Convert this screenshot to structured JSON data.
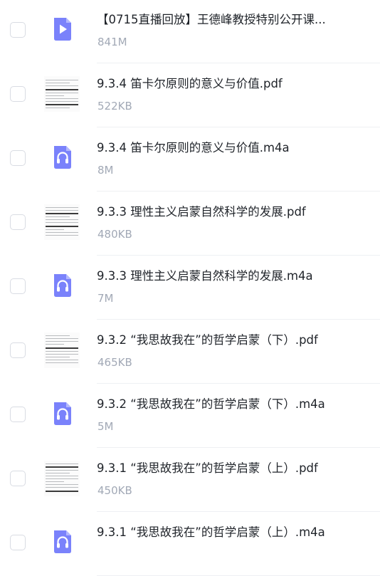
{
  "files": [
    {
      "name": "【0715直播回放】王德峰教授特别公开课...",
      "size": "841M",
      "type": "video",
      "icon": "play-icon"
    },
    {
      "name": "9.3.4 笛卡尔原则的意义与价值.pdf",
      "size": "522KB",
      "type": "pdf",
      "icon": "pdf-thumbnail-icon"
    },
    {
      "name": "9.3.4 笛卡尔原则的意义与价值.m4a",
      "size": "8M",
      "type": "audio",
      "icon": "headphones-icon"
    },
    {
      "name": "9.3.3 理性主义启蒙自然科学的发展.pdf",
      "size": "480KB",
      "type": "pdf",
      "icon": "pdf-thumbnail-icon"
    },
    {
      "name": "9.3.3 理性主义启蒙自然科学的发展.m4a",
      "size": "7M",
      "type": "audio",
      "icon": "headphones-icon"
    },
    {
      "name": "9.3.2 “我思故我在”的哲学启蒙（下）.pdf",
      "size": "465KB",
      "type": "pdf",
      "icon": "pdf-thumbnail-icon"
    },
    {
      "name": "9.3.2 “我思故我在”的哲学启蒙（下）.m4a",
      "size": "5M",
      "type": "audio",
      "icon": "headphones-icon"
    },
    {
      "name": "9.3.1 “我思故我在”的哲学启蒙（上）.pdf",
      "size": "450KB",
      "type": "pdf",
      "icon": "pdf-thumbnail-icon"
    },
    {
      "name": "9.3.1 “我思故我在”的哲学启蒙（上）.m4a",
      "size": "",
      "type": "audio",
      "icon": "headphones-icon"
    }
  ],
  "colors": {
    "media_icon_bg": "#7a82fb",
    "media_icon_fold": "#b3b8fd",
    "title_text": "#1f2329",
    "size_text": "#a2a9b6",
    "checkbox_border": "#d9dce3"
  }
}
